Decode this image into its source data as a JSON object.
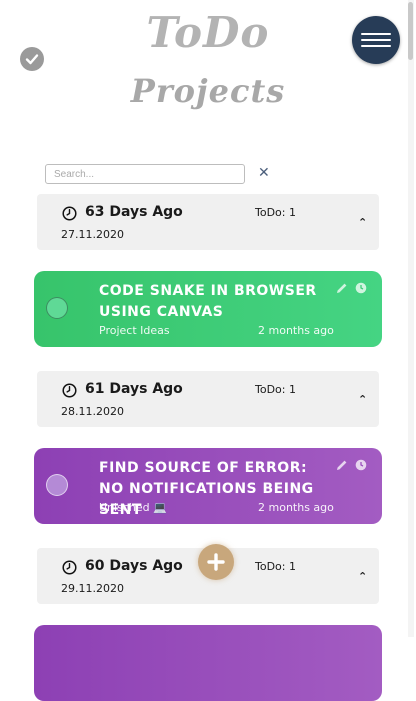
{
  "header": {
    "title_line1": "ToDo",
    "title_line2": "Projects",
    "status_icon": "check-circle-icon",
    "menu_icon": "hamburger-menu-icon"
  },
  "search": {
    "placeholder": "Search...",
    "clear_label": "✕"
  },
  "groups": [
    {
      "days_ago": "63 Days Ago",
      "date": "27.11.2020",
      "todo": "ToDo: 1",
      "task": {
        "title": "CODE SNAKE IN BROWSER USING CANVAS",
        "category": "Project Ideas",
        "ago": "2 months ago",
        "color": "#3ecb76"
      }
    },
    {
      "days_ago": "61 Days Ago",
      "date": "28.11.2020",
      "todo": "ToDo: 1",
      "task": {
        "title": "FIND SOURCE OF ERROR: NO NOTIFICATIONS BEING SENT",
        "category": "Unisched 💻",
        "ago": "2 months ago",
        "color": "#9a4fbd"
      }
    },
    {
      "days_ago": "60 Days Ago",
      "date": "29.11.2020",
      "todo": "ToDo: 1"
    }
  ],
  "colors": {
    "accent": "#273c57",
    "add": "#c8a77c",
    "green": "#3ecb76",
    "purple": "#9a4fbd"
  }
}
